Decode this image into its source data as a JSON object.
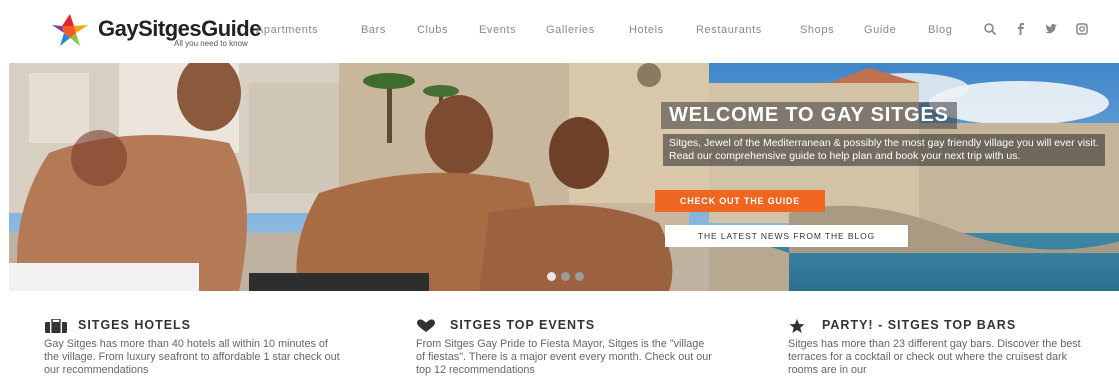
{
  "header": {
    "logo_title": "GaySitgesGuide",
    "logo_tagline": "All you need to know",
    "nav": [
      "Apartments",
      "Bars",
      "Clubs",
      "Events",
      "Galleries",
      "Hotels",
      "Restaurants",
      "Shops",
      "Guide",
      "Blog"
    ],
    "icons": [
      "search-icon",
      "facebook-icon",
      "twitter-icon",
      "instagram-icon"
    ]
  },
  "hero": {
    "title": "WELCOME TO GAY SITGES",
    "intro": "Sitges, Jewel of the Mediterranean & possibly the most gay friendly village you will ever visit. Read our comprehensive guide to help plan and book your next trip with us.",
    "cta_primary": "CHECK OUT THE GUIDE",
    "cta_secondary": "THE LATEST NEWS FROM THE BLOG",
    "slides": 3,
    "active_slide": 1
  },
  "features": [
    {
      "icon": "briefcase-icon",
      "title": "SITGES HOTELS",
      "text": "Gay Sitges has more than 40 hotels all within 10 minutes of the village. From luxury seafront to affordable 1 star check out our recommendations"
    },
    {
      "icon": "heart-icon",
      "title": "SITGES TOP EVENTS",
      "text": "From Sitges Gay Pride to Fiesta Mayor, Sitges is the \"village of fiestas\". There is a major event every month. Check out our top 12 recommendations"
    },
    {
      "icon": "star-icon",
      "title": "PARTY! - SITGES TOP BARS",
      "text": "Sitges has more than 23 different gay bars. Discover the best terraces for a cocktail or check out where the cruisest dark rooms are in our"
    }
  ],
  "colors": {
    "accent": "#ef6622",
    "nav_text": "#888888",
    "heading": "#333333"
  }
}
